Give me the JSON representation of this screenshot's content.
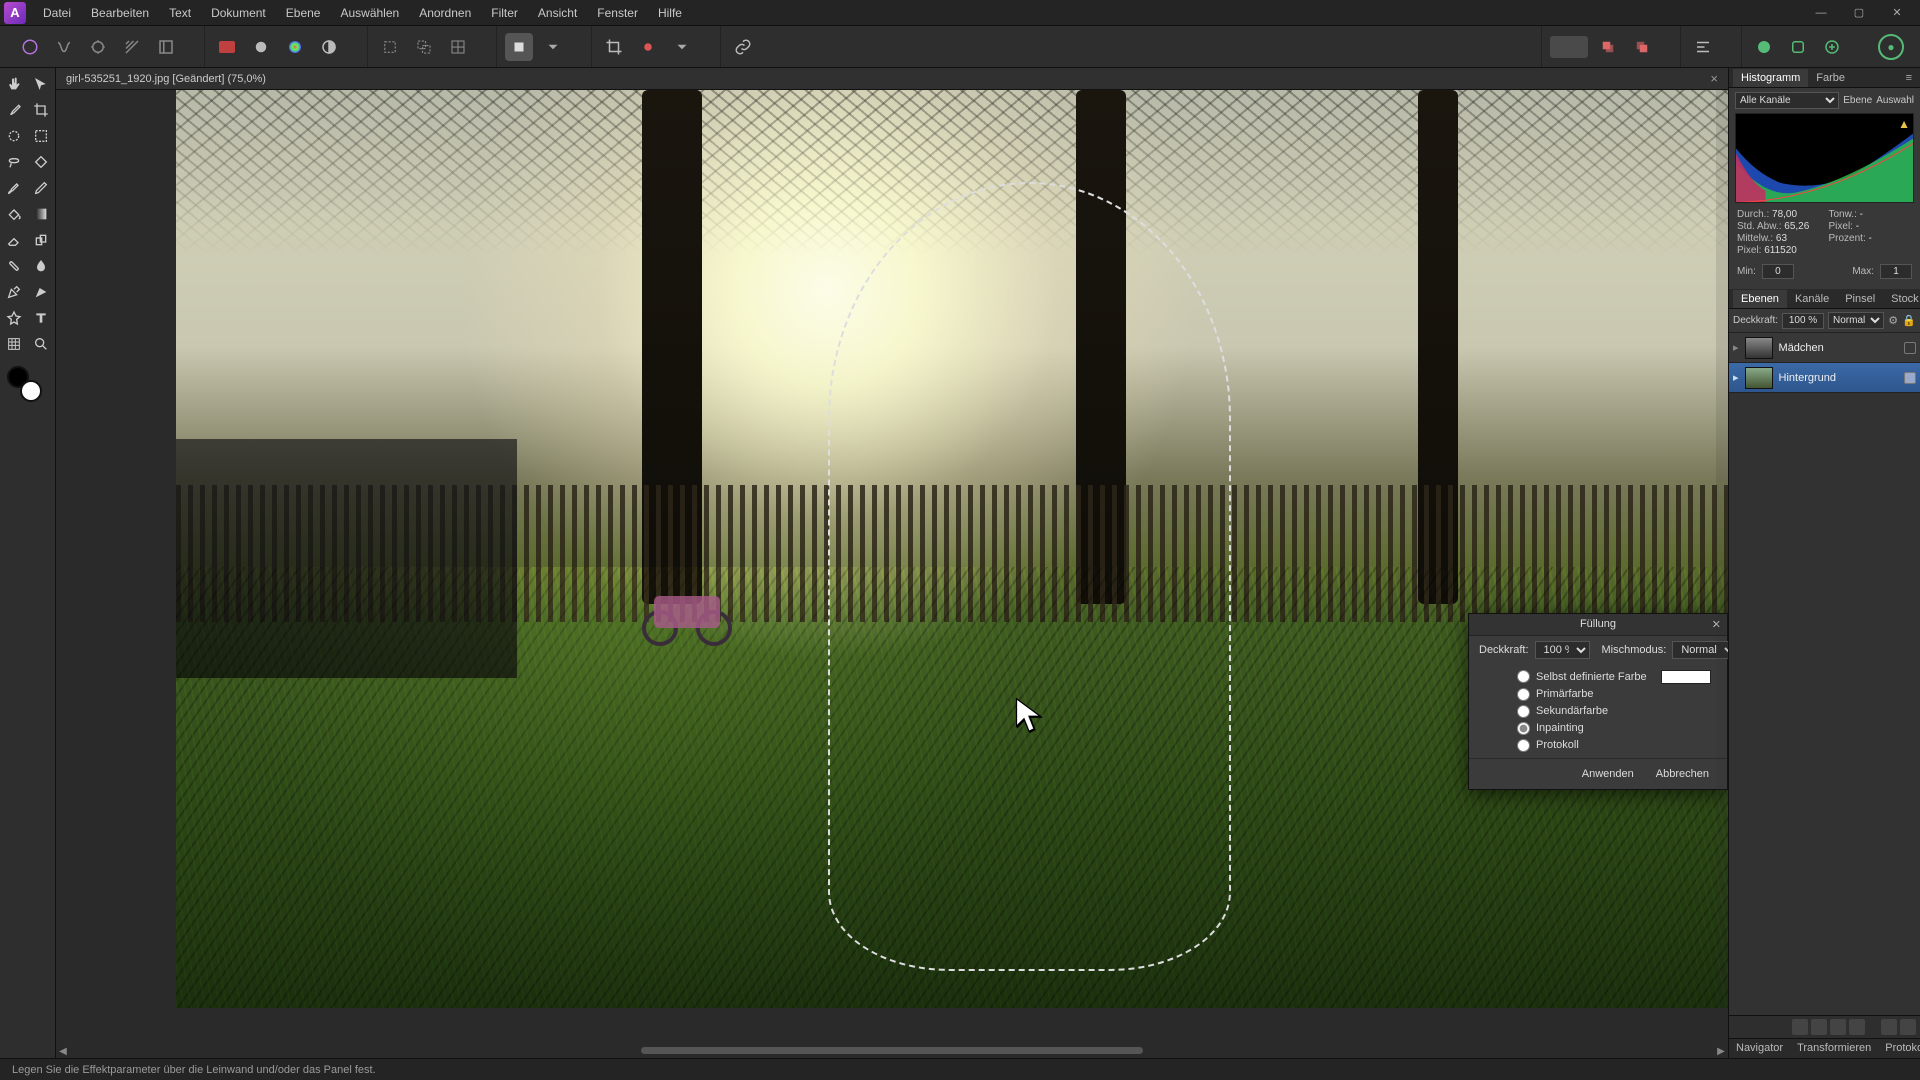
{
  "menu": [
    "Datei",
    "Bearbeiten",
    "Text",
    "Dokument",
    "Ebene",
    "Auswählen",
    "Anordnen",
    "Filter",
    "Ansicht",
    "Fenster",
    "Hilfe"
  ],
  "app_logo_letter": "A",
  "window": {
    "min": "—",
    "max": "▢",
    "close": "✕"
  },
  "document": {
    "tab_label": "girl-535251_1920.jpg [Geändert] (75,0%)",
    "close_x": "×"
  },
  "dialog_fill": {
    "title": "Füllung",
    "close": "✕",
    "opacity_label": "Deckkraft:",
    "opacity_value": "100 %",
    "blend_label": "Mischmodus:",
    "blend_value": "Normal",
    "options": {
      "custom": "Selbst definierte Farbe",
      "primary": "Primärfarbe",
      "secondary": "Sekundärfarbe",
      "inpainting": "Inpainting",
      "protocol": "Protokoll"
    },
    "selected": "inpainting",
    "apply": "Anwenden",
    "cancel": "Abbrechen"
  },
  "right": {
    "hist_tabs": [
      "Histogramm",
      "Farbe"
    ],
    "hist_channel": "Alle Kanäle",
    "hist_subtabs": [
      "Ebene",
      "Auswahl"
    ],
    "stats": {
      "durch_l": "Durch.:",
      "durch_v": "78,00",
      "tonw_l": "Tonw.:",
      "tonw_v": "-",
      "std_l": "Std. Abw.:",
      "std_v": "65,26",
      "pixel2_l": "Pixel:",
      "pixel2_v": "-",
      "mittel_l": "Mittelw.:",
      "mittel_v": "63",
      "proz_l": "Prozent:",
      "proz_v": "-",
      "pixel_l": "Pixel:",
      "pixel_v": "611520"
    },
    "min_l": "Min:",
    "min_v": "0",
    "max_l": "Max:",
    "max_v": "1",
    "layer_tabs": [
      "Ebenen",
      "Kanäle",
      "Pinsel",
      "Stock"
    ],
    "layer_opacity_l": "Deckkraft:",
    "layer_opacity_v": "100 %",
    "layer_blend": "Normal",
    "layers": [
      {
        "name": "Mädchen",
        "selected": false
      },
      {
        "name": "Hintergrund",
        "selected": true
      }
    ],
    "bottom_tabs": [
      "Navigator",
      "Transformieren",
      "Protokoll"
    ]
  },
  "statusbar": "Legen Sie die Effektparameter über die Leinwand und/oder das Panel fest."
}
